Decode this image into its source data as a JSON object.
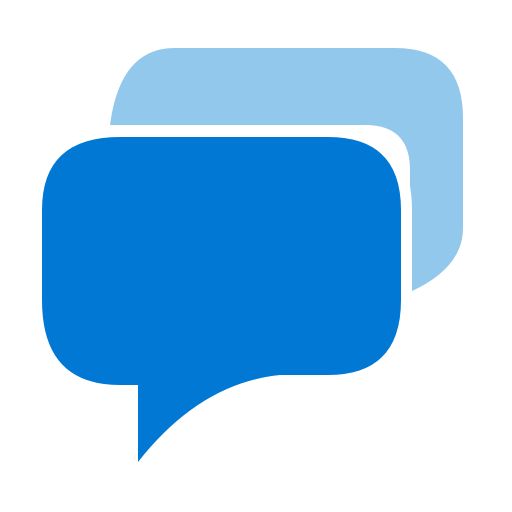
{
  "icon": {
    "name": "chat-bubbles-icon",
    "colors": {
      "back_bubble": "#92c8ec",
      "front_bubble": "#0078d4",
      "background": "#ffffff"
    }
  }
}
